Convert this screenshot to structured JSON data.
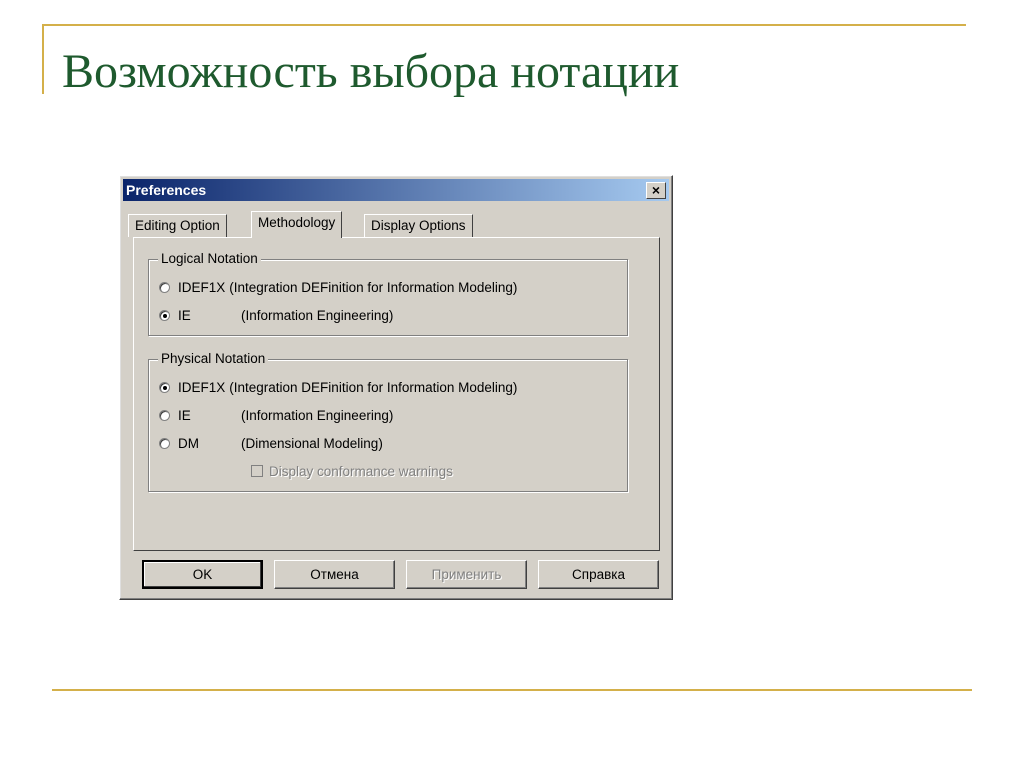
{
  "slide": {
    "title": "Возможность выбора нотации"
  },
  "dialog": {
    "title": "Preferences",
    "close_glyph": "×",
    "tabs": [
      {
        "label": "Editing Option",
        "active": false
      },
      {
        "label": "Methodology",
        "active": true
      },
      {
        "label": "Display Options",
        "active": false
      }
    ],
    "logical_notation": {
      "label": "Logical Notation",
      "options": [
        {
          "code": "IDEF1X",
          "description": "(Integration DEFinition for Information Modeling)",
          "checked": false
        },
        {
          "code": "IE",
          "description": "(Information Engineering)",
          "checked": true
        }
      ]
    },
    "physical_notation": {
      "label": "Physical Notation",
      "options": [
        {
          "code": "IDEF1X",
          "description": "(Integration DEFinition for Information Modeling)",
          "checked": true
        },
        {
          "code": "IE",
          "description": "(Information Engineering)",
          "checked": false
        },
        {
          "code": "DM",
          "description": "(Dimensional Modeling)",
          "checked": false
        }
      ],
      "conformance_checkbox": {
        "label": "Display conformance warnings",
        "checked": false,
        "enabled": false
      }
    },
    "buttons": {
      "ok": "OK",
      "cancel": "Отмена",
      "apply": "Применить",
      "help": "Справка"
    }
  },
  "colors": {
    "title_green": "#1e5a2e",
    "rule_gold": "#d4b04a",
    "dialog_face": "#d4d0c8",
    "titlebar_start": "#0a246a",
    "titlebar_end": "#a6caf0"
  }
}
